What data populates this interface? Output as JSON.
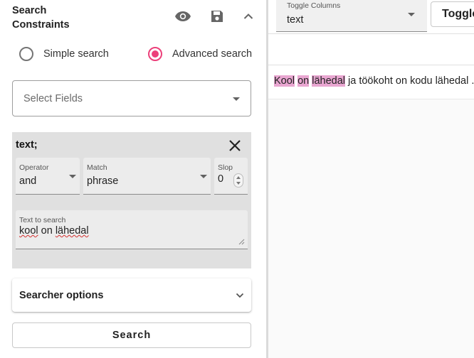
{
  "constraints_panel": {
    "title_line1": "Search",
    "title_line2": "Constraints",
    "icons": [
      "eye-icon",
      "save-icon",
      "chevron-up-icon"
    ]
  },
  "search_mode": {
    "options": [
      {
        "label": "Simple search",
        "selected": false
      },
      {
        "label": "Advanced search",
        "selected": true
      }
    ],
    "accent_color": "#ec407a"
  },
  "select_fields": {
    "placeholder": "Select Fields"
  },
  "constraint": {
    "field_name": "text;",
    "operator": {
      "label": "Operator",
      "value": "and"
    },
    "match": {
      "label": "Match",
      "value": "phrase"
    },
    "slop": {
      "label": "Slop",
      "value": "0"
    },
    "text_to_search": {
      "label": "Text to search",
      "words": [
        "kool",
        "on",
        "lähedal"
      ]
    }
  },
  "searcher_options": {
    "label": "Searcher options"
  },
  "search_button": {
    "label": "Search"
  },
  "results": {
    "toggle_columns": {
      "label": "Toggle Columns",
      "value": "text"
    },
    "toggle_button": {
      "label": "Toggle"
    },
    "highlight_color": "#e9a6d1",
    "row": {
      "segments": [
        {
          "text": "Kool",
          "highlight": true
        },
        {
          "text": " ",
          "highlight": false
        },
        {
          "text": "on",
          "highlight": true
        },
        {
          "text": " ",
          "highlight": false
        },
        {
          "text": "lähedal",
          "highlight": true
        },
        {
          "text": " ja töökoht on kodu lähedal ...",
          "highlight": false
        }
      ]
    }
  }
}
